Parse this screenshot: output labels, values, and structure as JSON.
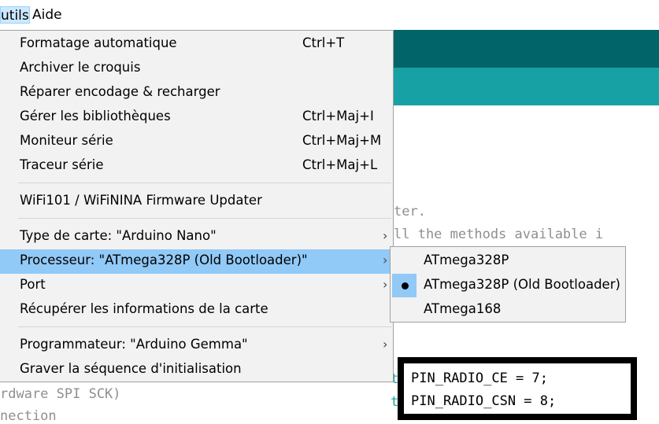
{
  "menubar": {
    "outils": "utils",
    "aide": "Aide"
  },
  "menu": {
    "items": [
      {
        "label": "Formatage automatique",
        "shortcut": "Ctrl+T"
      },
      {
        "label": "Archiver le croquis",
        "shortcut": ""
      },
      {
        "label": "Réparer encodage & recharger",
        "shortcut": ""
      },
      {
        "label": "Gérer les bibliothèques",
        "shortcut": "Ctrl+Maj+I"
      },
      {
        "label": "Moniteur série",
        "shortcut": "Ctrl+Maj+M"
      },
      {
        "label": "Traceur série",
        "shortcut": "Ctrl+Maj+L"
      },
      {
        "label": "WiFi101 / WiFiNINA Firmware Updater",
        "shortcut": ""
      },
      {
        "label": "Type de carte: \"Arduino Nano\"",
        "shortcut": ""
      },
      {
        "label": "Processeur: \"ATmega328P (Old Bootloader)\"",
        "shortcut": ""
      },
      {
        "label": "Port",
        "shortcut": ""
      },
      {
        "label": "Récupérer les informations de la carte",
        "shortcut": ""
      },
      {
        "label": "Programmateur: \"Arduino Gemma\"",
        "shortcut": ""
      },
      {
        "label": "Graver la séquence d'initialisation",
        "shortcut": ""
      }
    ],
    "arrow": "›"
  },
  "submenu": {
    "items": [
      {
        "label": "ATmega328P"
      },
      {
        "label": "ATmega328P (Old Bootloader)"
      },
      {
        "label": "ATmega168"
      }
    ]
  },
  "code": {
    "line1": "ter.",
    "line2": "ll the methods available i",
    "line3": "rdware SPI SCK)",
    "line4": "nection",
    "t1": "t",
    "t2": "t",
    "box_line1": "PIN_RADIO_CE = 7;",
    "box_line2": "PIN_RADIO_CSN = 8;"
  },
  "colors": {
    "highlight": "#91c9f7",
    "teal_dark": "#006468",
    "teal": "#17a1a5"
  }
}
